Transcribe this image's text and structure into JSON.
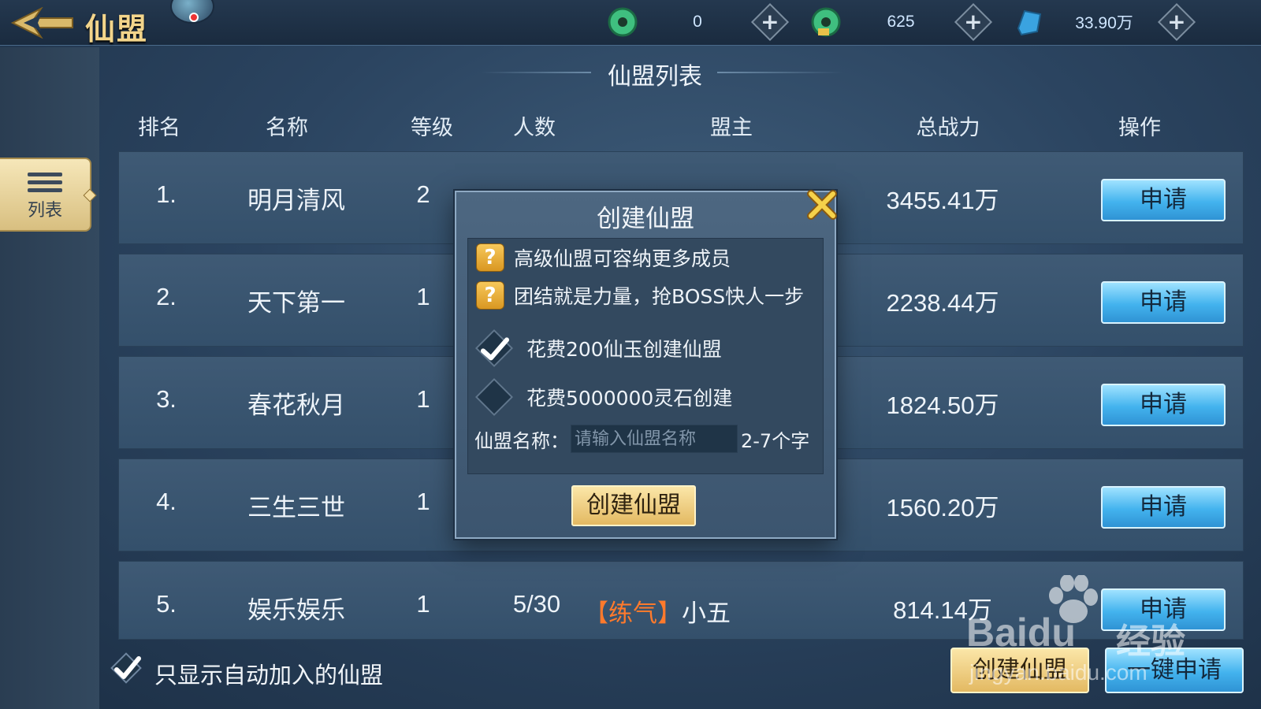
{
  "header": {
    "title": "仙盟",
    "currencies": [
      {
        "icon": "jade-icon",
        "value": "0"
      },
      {
        "icon": "bound-jade-icon",
        "value": "625"
      },
      {
        "icon": "spirit-stone-icon",
        "value": "33.90万"
      }
    ]
  },
  "sidebar": {
    "tab_label": "列表"
  },
  "list": {
    "title": "仙盟列表",
    "columns": [
      "排名",
      "名称",
      "等级",
      "人数",
      "盟主",
      "总战力",
      "操作"
    ],
    "rows": [
      {
        "rank": "1.",
        "name": "明月清风",
        "level": "2",
        "members": "",
        "leader_tag": "",
        "leader": "",
        "power": "3455.41万",
        "action": "申请"
      },
      {
        "rank": "2.",
        "name": "天下第一",
        "level": "1",
        "members": "",
        "leader_tag": "",
        "leader": "",
        "power": "2238.44万",
        "action": "申请"
      },
      {
        "rank": "3.",
        "name": "春花秋月",
        "level": "1",
        "members": "",
        "leader_tag": "",
        "leader": "",
        "power": "1824.50万",
        "action": "申请"
      },
      {
        "rank": "4.",
        "name": "三生三世",
        "level": "1",
        "members": "",
        "leader_tag": "",
        "leader": "",
        "power": "1560.20万",
        "action": "申请"
      },
      {
        "rank": "5.",
        "name": "娱乐娱乐",
        "level": "1",
        "members": "5/30",
        "leader_tag": "【练气】",
        "leader": "小五",
        "power": "814.14万",
        "action": "申请"
      }
    ]
  },
  "footer": {
    "filter_label": "只显示自动加入的仙盟",
    "filter_checked": true,
    "create_label": "创建仙盟",
    "apply_all_label": "一键申请"
  },
  "modal": {
    "title": "创建仙盟",
    "tips": [
      "高级仙盟可容纳更多成员",
      "团结就是力量，抢BOSS快人一步"
    ],
    "options": [
      {
        "label": "花费200仙玉创建仙盟",
        "checked": true
      },
      {
        "label": "花费5000000灵石创建",
        "checked": false
      }
    ],
    "name_label": "仙盟名称：",
    "name_placeholder": "请输入仙盟名称",
    "name_hint": "2-7个字",
    "create_label": "创建仙盟"
  },
  "watermark": {
    "brand": "Baidu",
    "cn": "经验",
    "url": "jingyan.baidu.com"
  }
}
